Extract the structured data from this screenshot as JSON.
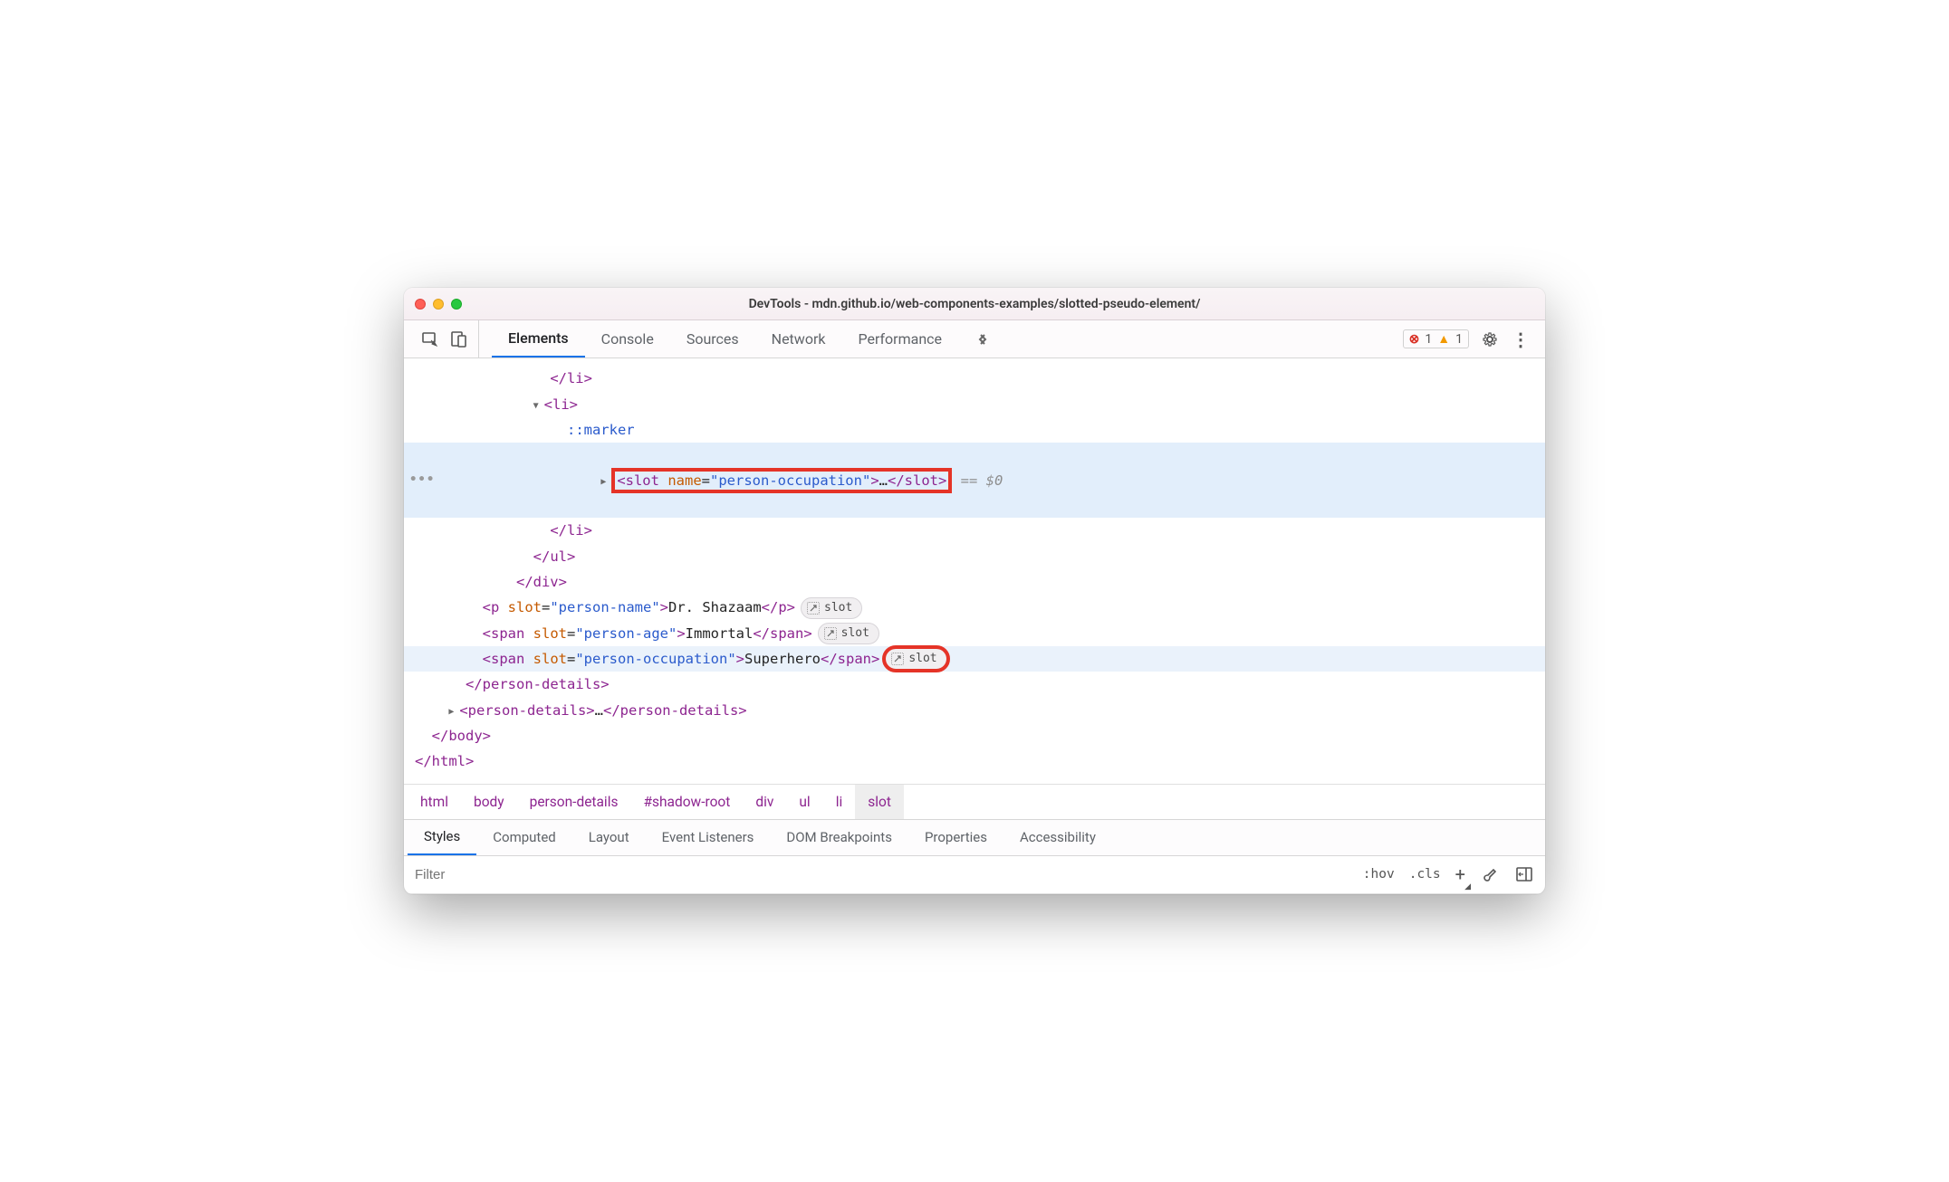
{
  "window": {
    "title": "DevTools - mdn.github.io/web-components-examples/slotted-pseudo-element/"
  },
  "mainTabs": {
    "elements": "Elements",
    "console": "Console",
    "sources": "Sources",
    "network": "Network",
    "performance": "Performance"
  },
  "status": {
    "errors": "1",
    "warnings": "1"
  },
  "tree": {
    "li_close1": "</li>",
    "li_open": "<li>",
    "marker": "::marker",
    "slot_open": "<slot",
    "slot_attr_name": "name",
    "slot_attr_eq": "=",
    "slot_attr_val": "\"person-occupation\"",
    "slot_close_angle": ">",
    "slot_ellipsis": "…",
    "slot_close": "</slot>",
    "eq0": " == $0",
    "li_close2": "</li>",
    "ul_close": "</ul>",
    "div_close": "</div>",
    "p_open": "<p",
    "p_slot_attr": "slot",
    "p_slot_val": "\"person-name\"",
    "p_text": "Dr. Shazaam",
    "p_close": "</p>",
    "span_open": "<span",
    "span1_val": "\"person-age\"",
    "span1_text": "Immortal",
    "span_close": "</span>",
    "span2_val": "\"person-occupation\"",
    "span2_text": "Superhero",
    "pd_close": "</person-details>",
    "pd_open2": "<person-details>",
    "pd_ell": "…",
    "pd_close2": "</person-details>",
    "body_close": "</body>",
    "html_close": "</html>",
    "slot_badge": "slot"
  },
  "breadcrumb": {
    "items": [
      "html",
      "body",
      "person-details",
      "#shadow-root",
      "div",
      "ul",
      "li",
      "slot"
    ],
    "activeIndex": 7
  },
  "subtabs": {
    "styles": "Styles",
    "computed": "Computed",
    "layout": "Layout",
    "event": "Event Listeners",
    "dom": "DOM Breakpoints",
    "props": "Properties",
    "a11y": "Accessibility"
  },
  "filter": {
    "placeholder": "Filter",
    "hov": ":hov",
    "cls": ".cls"
  }
}
